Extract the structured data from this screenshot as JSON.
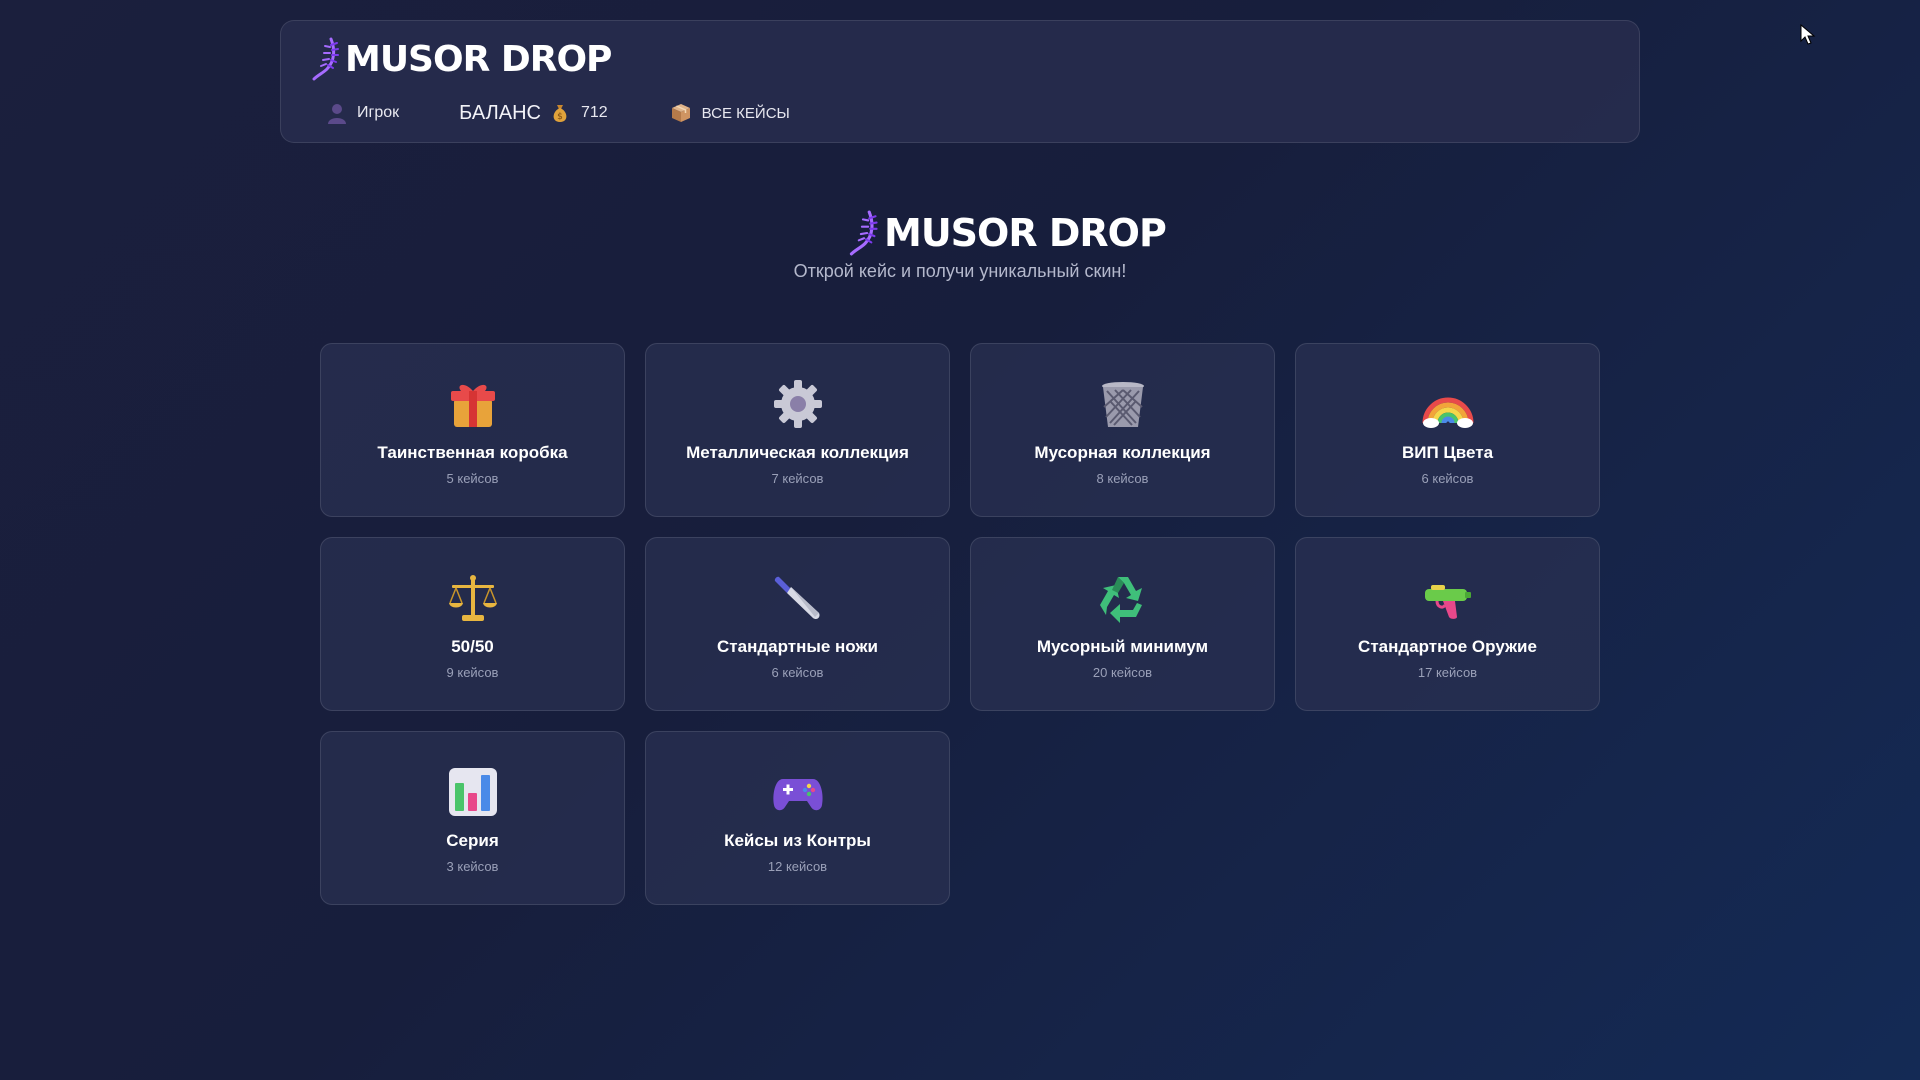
{
  "brand": {
    "name": "MUSOR DROP"
  },
  "nav": {
    "user_label": "Игрок",
    "balance_label": "БАЛАНС",
    "balance_value": "712",
    "all_cases_label": "ВСЕ КЕЙСЫ"
  },
  "hero": {
    "title": "MUSOR DROP",
    "subtitle": "Открой кейс и получи уникальный скин!"
  },
  "categories": [
    {
      "title": "Таинственная коробка",
      "count": "5 кейсов",
      "icon": "gift-icon"
    },
    {
      "title": "Металлическая коллекция",
      "count": "7 кейсов",
      "icon": "gear-icon"
    },
    {
      "title": "Мусорная коллекция",
      "count": "8 кейсов",
      "icon": "wastebasket-icon"
    },
    {
      "title": "ВИП Цвета",
      "count": "6 кейсов",
      "icon": "rainbow-icon"
    },
    {
      "title": "50/50",
      "count": "9 кейсов",
      "icon": "balance-scale-icon"
    },
    {
      "title": "Стандартные ножи",
      "count": "6 кейсов",
      "icon": "knife-icon"
    },
    {
      "title": "Мусорный минимум",
      "count": "20 кейсов",
      "icon": "recycle-icon"
    },
    {
      "title": "Стандартное Оружие",
      "count": "17 кейсов",
      "icon": "water-pistol-icon"
    },
    {
      "title": "Серия",
      "count": "3 кейсов",
      "icon": "bar-chart-icon"
    },
    {
      "title": "Кейсы из Контры",
      "count": "12 кейсов",
      "icon": "gamepad-icon"
    }
  ],
  "colors": {
    "accent": "#8b5cf6",
    "background": "#1b1f3d",
    "card": "#2a3052"
  }
}
